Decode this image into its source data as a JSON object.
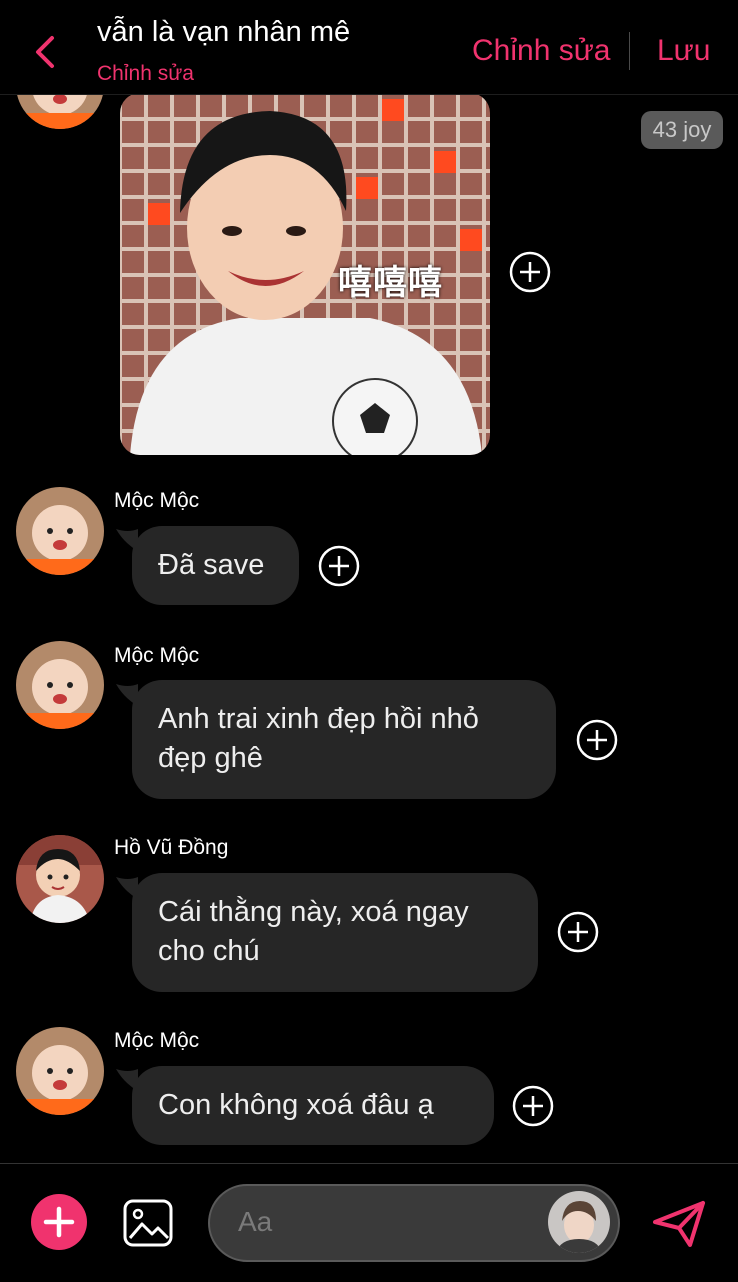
{
  "header": {
    "title": "vẫn là vạn nhân mê",
    "subtitle": "Chỉnh sửa",
    "edit_label": "Chỉnh sửa",
    "save_label": "Lưu"
  },
  "photo_message": {
    "caption": "嘻嘻嘻",
    "reaction_count": "43 joy"
  },
  "messages": [
    {
      "sender": "Mộc Mộc",
      "text": "Đã save"
    },
    {
      "sender": "Mộc Mộc",
      "text": "Anh trai xinh đẹp hồi nhỏ đẹp ghê"
    },
    {
      "sender": "Hồ Vũ Đồng",
      "text": "Cái thằng này, xoá ngay cho chú"
    },
    {
      "sender": "Mộc Mộc",
      "text": "Con không xoá đâu ạ"
    }
  ],
  "composer": {
    "placeholder": "Aa"
  },
  "colors": {
    "accent": "#f0336e",
    "bubble": "#262626",
    "background": "#000000"
  },
  "icons": [
    "chevron-left-icon",
    "plus-circle-icon",
    "add-icon",
    "gallery-icon",
    "send-icon"
  ]
}
